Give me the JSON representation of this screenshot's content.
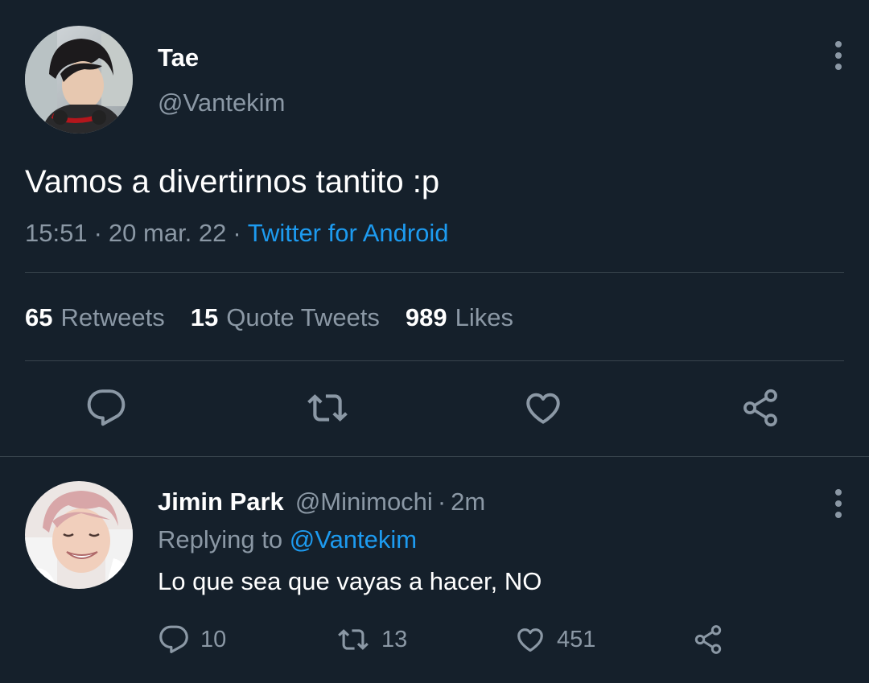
{
  "theme": {
    "background": "#15202b",
    "text_primary": "#ffffff",
    "text_secondary": "#8b98a5",
    "accent": "#1d9bf0",
    "divider": "#38444d"
  },
  "tweet": {
    "author": {
      "name": "Tae",
      "handle": "@Vantekim",
      "avatar_icon": "avatar-photo"
    },
    "text": "Vamos a divertirnos tantito :p",
    "time": "15:51",
    "date": "20 mar. 22",
    "separator": "·",
    "source": "Twitter for Android",
    "stats": {
      "retweets_count": "65",
      "retweets_label": "Retweets",
      "quotes_count": "15",
      "quotes_label": "Quote Tweets",
      "likes_count": "989",
      "likes_label": "Likes"
    },
    "actions": [
      "reply-icon",
      "retweet-icon",
      "like-icon",
      "share-icon"
    ]
  },
  "reply": {
    "author": {
      "name": "Jimin Park",
      "handle": "@Minimochi",
      "avatar_icon": "avatar-photo"
    },
    "separator": "·",
    "time_ago": "2m",
    "replying_label": "Replying to",
    "replying_to": "@Vantekim",
    "text": "Lo que sea que vayas a hacer, NO",
    "counts": {
      "replies": "10",
      "retweets": "13",
      "likes": "451"
    }
  }
}
